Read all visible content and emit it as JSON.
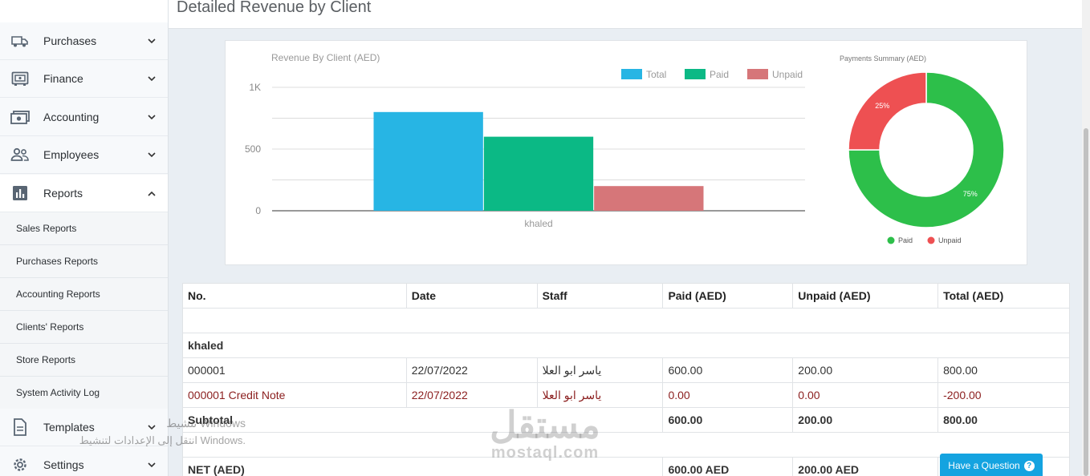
{
  "page": {
    "title": "Detailed Revenue by Client"
  },
  "sidebar": {
    "items": [
      {
        "label": "Purchases",
        "icon": "truck-icon"
      },
      {
        "label": "Finance",
        "icon": "safe-icon"
      },
      {
        "label": "Accounting",
        "icon": "money-icon"
      },
      {
        "label": "Employees",
        "icon": "people-icon"
      },
      {
        "label": "Reports",
        "icon": "bar-chart-icon",
        "expanded": true
      },
      {
        "label": "Templates",
        "icon": "document-icon"
      },
      {
        "label": "Settings",
        "icon": "gear-icon"
      }
    ],
    "report_subitems": [
      "Sales Reports",
      "Purchases Reports",
      "Accounting Reports",
      "Clients' Reports",
      "Store Reports",
      "System Activity Log"
    ]
  },
  "chart_data": [
    {
      "type": "bar",
      "title": "Revenue By Client (AED)",
      "categories": [
        "khaled"
      ],
      "series": [
        {
          "name": "Total",
          "values": [
            800
          ],
          "color": "#27b5e4"
        },
        {
          "name": "Paid",
          "values": [
            600
          ],
          "color": "#0bb985"
        },
        {
          "name": "Unpaid",
          "values": [
            200
          ],
          "color": "#d67679"
        }
      ],
      "ylim": [
        0,
        1000
      ],
      "yticks": [
        {
          "value": 0,
          "label": "0"
        },
        {
          "value": 500,
          "label": "500"
        },
        {
          "value": 1000,
          "label": "1K"
        }
      ],
      "grid": true,
      "legend": "top-right"
    },
    {
      "type": "pie",
      "title": "Payments Summary (AED)",
      "slices": [
        {
          "name": "Paid",
          "value": 75,
          "label": "75%",
          "color": "#2dbf4a"
        },
        {
          "name": "Unpaid",
          "value": 25,
          "label": "25%",
          "color": "#ee5052"
        }
      ],
      "donut": true,
      "legend": "bottom"
    }
  ],
  "table": {
    "headers": [
      "No.",
      "Date",
      "Staff",
      "Paid (AED)",
      "Unpaid (AED)",
      "Total (AED)"
    ],
    "group": "khaled",
    "rows": [
      {
        "no": "000001",
        "date": "22/07/2022",
        "staff": "ياسر ابو العلا",
        "paid": "600.00",
        "unpaid": "200.00",
        "total": "800.00"
      },
      {
        "no": "000001 Credit Note",
        "date": "22/07/2022",
        "staff": "ياسر ابو العلا",
        "paid": "0.00",
        "unpaid": "0.00",
        "total": "-200.00"
      }
    ],
    "subtotal": {
      "label": "Subtotal",
      "paid": "600.00",
      "unpaid": "200.00",
      "total": "800.00"
    },
    "net": {
      "label": "NET (AED)",
      "paid": "600.00 AED",
      "unpaid": "200.00 AED",
      "total": ""
    }
  },
  "overlay": {
    "windows_line1": "تنشيط Windows",
    "windows_line2": "انتقل إلى الإعدادات لتنشيط Windows.",
    "watermark_ar": "مستقل",
    "watermark_en": "mostaql.com",
    "help_button": "Have a Question",
    "help_icon": "question-icon"
  }
}
